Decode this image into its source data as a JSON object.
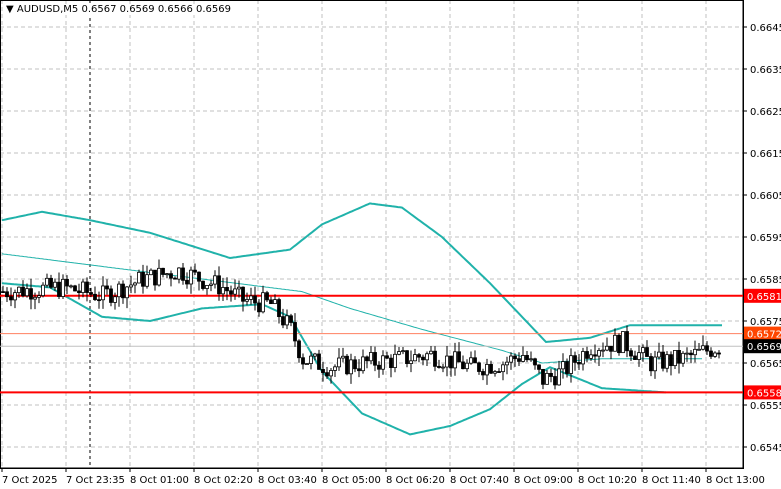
{
  "title": {
    "symbol": "AUDUSD,M5",
    "ohlc": "0.6567 0.6569 0.6566 0.6569"
  },
  "chart_data": {
    "type": "candlestick",
    "symbol": "AUDUSD",
    "timeframe": "M5",
    "ylim": [
      0.6541,
      0.6652
    ],
    "bars": 180,
    "y_ticks": [
      "0.6645",
      "0.6635",
      "0.6625",
      "0.6615",
      "0.6605",
      "0.6595",
      "0.6585",
      "0.6575",
      "0.6565",
      "0.6555",
      "0.6545"
    ],
    "x_ticks": [
      {
        "bar": 0,
        "label": "7 Oct 2025"
      },
      {
        "bar": 16,
        "label": "7 Oct 23:35"
      },
      {
        "bar": 32,
        "label": "8 Oct 01:00"
      },
      {
        "bar": 48,
        "label": "8 Oct 02:20"
      },
      {
        "bar": 64,
        "label": "8 Oct 03:40"
      },
      {
        "bar": 80,
        "label": "8 Oct 05:00"
      },
      {
        "bar": 96,
        "label": "8 Oct 06:20"
      },
      {
        "bar": 112,
        "label": "8 Oct 07:40"
      },
      {
        "bar": 128,
        "label": "8 Oct 09:00"
      },
      {
        "bar": 144,
        "label": "8 Oct 10:20"
      },
      {
        "bar": 160,
        "label": "8 Oct 11:40"
      },
      {
        "bar": 176,
        "label": "8 Oct 13:00"
      }
    ],
    "cursor_bar": 22,
    "price_path": [
      [
        0,
        0.6582
      ],
      [
        15,
        0.6583
      ],
      [
        25,
        0.6581
      ],
      [
        35,
        0.6585
      ],
      [
        44,
        0.6587
      ],
      [
        55,
        0.6583
      ],
      [
        60,
        0.658
      ],
      [
        67,
        0.6579
      ],
      [
        72,
        0.6573
      ],
      [
        75,
        0.6566
      ],
      [
        82,
        0.6564
      ],
      [
        90,
        0.6565
      ],
      [
        100,
        0.6566
      ],
      [
        107,
        0.6567
      ],
      [
        117,
        0.6564
      ],
      [
        125,
        0.6565
      ],
      [
        130,
        0.6567
      ],
      [
        135,
        0.6561
      ],
      [
        140,
        0.6563
      ],
      [
        147,
        0.6569
      ],
      [
        155,
        0.657
      ],
      [
        162,
        0.6565
      ],
      [
        170,
        0.6566
      ],
      [
        179,
        0.6569
      ]
    ],
    "bands": {
      "upper": [
        [
          0,
          0.6599
        ],
        [
          10,
          0.6601
        ],
        [
          22,
          0.6599
        ],
        [
          37,
          0.6596
        ],
        [
          57,
          0.659
        ],
        [
          72,
          0.6592
        ],
        [
          80,
          0.6598
        ],
        [
          92,
          0.6603
        ],
        [
          100,
          0.6602
        ],
        [
          110,
          0.6595
        ],
        [
          122,
          0.6584
        ],
        [
          130,
          0.6576
        ],
        [
          136,
          0.657
        ],
        [
          147,
          0.6571
        ],
        [
          157,
          0.6574
        ],
        [
          170,
          0.6574
        ],
        [
          180,
          0.6574
        ]
      ],
      "middle": [
        [
          0,
          0.6591
        ],
        [
          25,
          0.6588
        ],
        [
          50,
          0.6585
        ],
        [
          75,
          0.6582
        ],
        [
          87,
          0.6578
        ],
        [
          105,
          0.6573
        ],
        [
          125,
          0.6568
        ],
        [
          135,
          0.6565
        ],
        [
          150,
          0.6566
        ],
        [
          162,
          0.6566
        ],
        [
          175,
          0.6566
        ]
      ],
      "lower": [
        [
          0,
          0.6584
        ],
        [
          12,
          0.6583
        ],
        [
          25,
          0.6576
        ],
        [
          37,
          0.6575
        ],
        [
          50,
          0.6578
        ],
        [
          65,
          0.6579
        ],
        [
          72,
          0.6576
        ],
        [
          80,
          0.6563
        ],
        [
          90,
          0.6553
        ],
        [
          102,
          0.6548
        ],
        [
          112,
          0.655
        ],
        [
          122,
          0.6554
        ],
        [
          130,
          0.656
        ],
        [
          137,
          0.6564
        ],
        [
          150,
          0.6559
        ],
        [
          166,
          0.6558
        ]
      ]
    },
    "levels": [
      {
        "price": "0.6581",
        "color": "#ff0000"
      },
      {
        "price": "0.6558",
        "color": "#ff0000"
      }
    ],
    "ask": {
      "price": "0.6572",
      "color": "#ff4500"
    },
    "bid": {
      "price": "0.6569",
      "color": "#000000"
    },
    "band_color": "#20b2aa"
  }
}
